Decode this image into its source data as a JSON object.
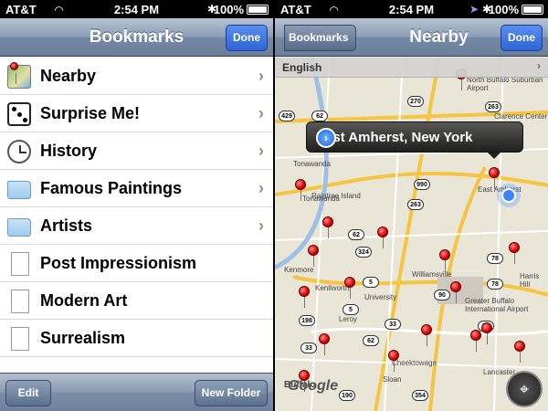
{
  "left": {
    "status": {
      "carrier": "AT&T",
      "time": "2:54 PM",
      "battery": "100%"
    },
    "nav": {
      "title": "Bookmarks",
      "done": "Done"
    },
    "rows": [
      {
        "label": "Nearby",
        "icon": "map-pin-icon",
        "chevron": true
      },
      {
        "label": "Surprise Me!",
        "icon": "dice-icon",
        "chevron": true
      },
      {
        "label": "History",
        "icon": "clock-icon",
        "chevron": true
      },
      {
        "label": "Famous Paintings",
        "icon": "folder-icon",
        "chevron": true
      },
      {
        "label": "Artists",
        "icon": "folder-icon",
        "chevron": true
      },
      {
        "label": "Post Impressionism",
        "icon": "document-icon",
        "chevron": false
      },
      {
        "label": "Modern Art",
        "icon": "document-icon",
        "chevron": false
      },
      {
        "label": "Surrealism",
        "icon": "document-icon",
        "chevron": false
      }
    ],
    "toolbar": {
      "edit": "Edit",
      "new_folder": "New Folder"
    }
  },
  "right": {
    "status": {
      "carrier": "AT&T",
      "time": "2:54 PM",
      "battery": "100%"
    },
    "nav": {
      "back": "Bookmarks",
      "title": "Nearby",
      "done": "Done"
    },
    "language": "English",
    "callout": "East Amherst, New York",
    "map_labels": [
      "North Buffalo Suburban Airport",
      "Clarence Center",
      "Tonawanda",
      "Raintree Island",
      "East Amherst",
      "Tonawanda",
      "Kenmore",
      "Kenilworth",
      "University",
      "Williamsville",
      "Harris Hill",
      "Greater Buffalo International Airport",
      "Leroy",
      "Cheektowaga",
      "Sloan",
      "Lancaster",
      "Buffalo",
      "Google"
    ],
    "route_shields": [
      "270",
      "429",
      "263",
      "62",
      "990",
      "263",
      "62",
      "324",
      "78",
      "5",
      "78",
      "90",
      "5",
      "198",
      "33",
      "78",
      "62",
      "33",
      "190",
      "354"
    ]
  },
  "colors": {
    "accent": "#2d64d8",
    "pin": "#d80000",
    "navbar": "#6b7f9b"
  }
}
